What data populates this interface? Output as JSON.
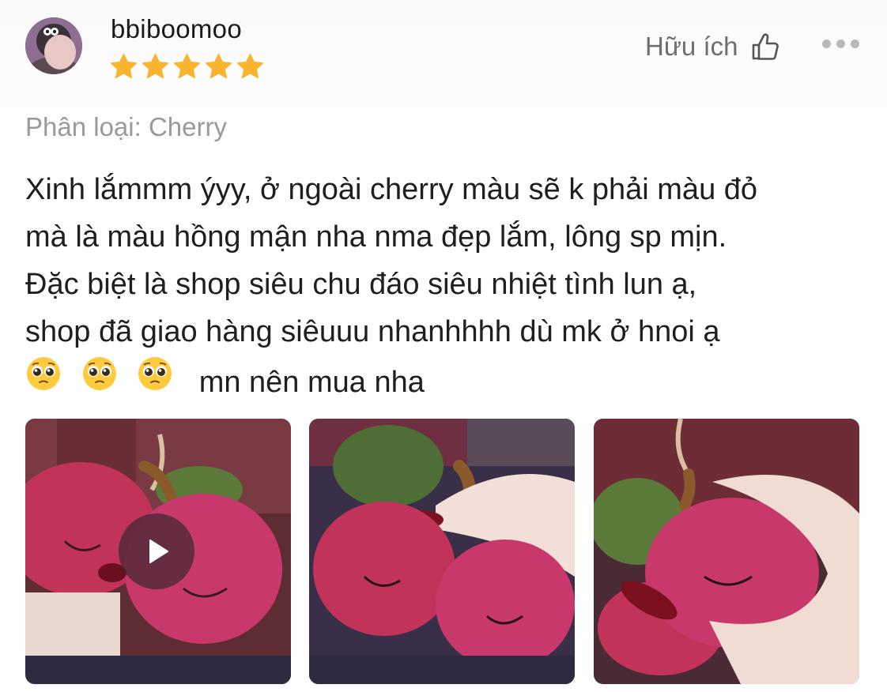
{
  "review": {
    "username": "bbiboomoo",
    "rating": 5,
    "helpful_label": "Hữu ích",
    "variant_label": "Phân loại: Cherry",
    "body_lines": [
      "Xinh lắmmm ýyy, ở ngoài cherry màu sẽ k phải màu đỏ",
      "mà là màu hồng mận nha nma đẹp lắm, lông sp mịn.",
      "Đặc biệt là shop siêu chu đáo siêu nhiệt tình lun ạ,",
      "shop đã giao hàng siêuuu nhanhhhh dù mk ở hnoi ạ"
    ],
    "last_line_text": "mn nên mua nha",
    "emojis": [
      "pleading-face-icon",
      "pleading-face-icon",
      "pleading-face-icon"
    ],
    "media": [
      {
        "type": "video",
        "subject": "cherry plush keychain"
      },
      {
        "type": "image",
        "subject": "cherry plush keychain"
      },
      {
        "type": "image",
        "subject": "cherry plush keychain"
      }
    ]
  },
  "colors": {
    "star": "#F7B42C",
    "plush": "#C2335A",
    "leaf": "#5B7A3A",
    "text": "#1F1F1F",
    "muted": "#9A9A9A"
  }
}
